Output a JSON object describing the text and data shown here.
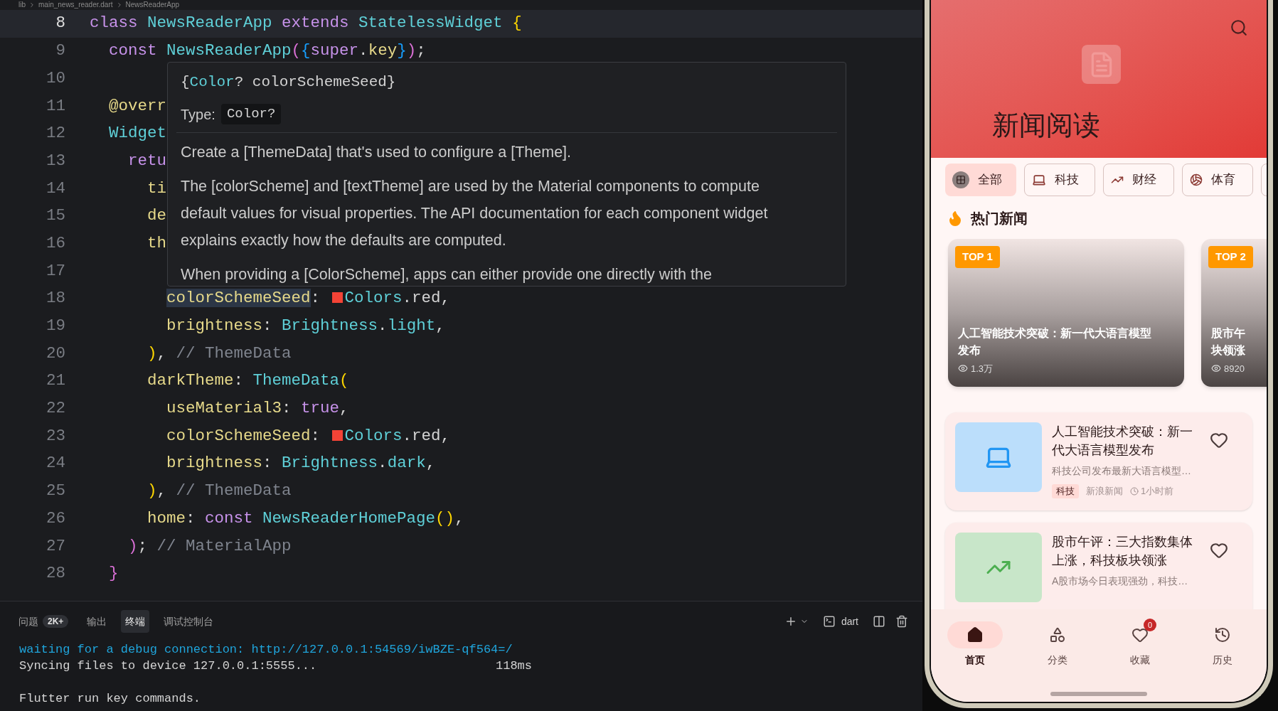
{
  "breadcrumb": [
    "lib",
    "main_news_reader.dart",
    "NewsReaderApp"
  ],
  "editor": {
    "lines": [
      {
        "number": "8",
        "current": true,
        "tokens": [
          {
            "kind": "kw",
            "text": "class "
          },
          {
            "kind": "type",
            "text": "NewsReaderApp "
          },
          {
            "kind": "kw",
            "text": "extends "
          },
          {
            "kind": "type",
            "text": "StatelessWidget "
          },
          {
            "kind": "b1",
            "text": "{"
          }
        ]
      },
      {
        "number": "9",
        "current": false,
        "tokens": [
          {
            "kind": "kw",
            "text": "  const "
          },
          {
            "kind": "type",
            "text": "NewsReaderApp"
          },
          {
            "kind": "b2",
            "text": "("
          },
          {
            "kind": "b3",
            "text": "{"
          },
          {
            "kind": "kw",
            "text": "super"
          },
          {
            "kind": "plain",
            "text": "."
          },
          {
            "kind": "prop",
            "text": "key"
          },
          {
            "kind": "b3",
            "text": "}"
          },
          {
            "kind": "b2",
            "text": ")"
          },
          {
            "kind": "plain",
            "text": ";"
          }
        ]
      },
      {
        "number": "10",
        "current": false
      },
      {
        "number": "11",
        "current": false,
        "tokens": [
          {
            "kind": "prop",
            "text": "  @overr"
          }
        ]
      },
      {
        "number": "12",
        "current": false,
        "tokens": [
          {
            "kind": "type",
            "text": "  Widget"
          }
        ]
      },
      {
        "number": "13",
        "current": false,
        "tokens": [
          {
            "kind": "kw",
            "text": "    retu"
          }
        ]
      },
      {
        "number": "14",
        "current": false,
        "tokens": [
          {
            "kind": "prop",
            "text": "      ti"
          }
        ]
      },
      {
        "number": "15",
        "current": false,
        "tokens": [
          {
            "kind": "prop",
            "text": "      de"
          }
        ]
      },
      {
        "number": "16",
        "current": false,
        "tokens": [
          {
            "kind": "prop",
            "text": "      th"
          }
        ]
      },
      {
        "number": "17",
        "current": false
      },
      {
        "number": "18",
        "current": false,
        "tokens": [
          {
            "kind": "prop",
            "text": "        colorSchemeSeed",
            "highlighted": true
          },
          {
            "kind": "plain",
            "text": ": "
          },
          {
            "kind": "swatch",
            "color": "#f44336"
          },
          {
            "kind": "type",
            "text": "Colors"
          },
          {
            "kind": "plain",
            "text": ".red,"
          }
        ]
      },
      {
        "number": "19",
        "current": false,
        "tokens": [
          {
            "kind": "prop",
            "text": "        brightness"
          },
          {
            "kind": "plain",
            "text": ": "
          },
          {
            "kind": "type",
            "text": "Brightness"
          },
          {
            "kind": "plain",
            "text": "."
          },
          {
            "kind": "type",
            "text": "light"
          },
          {
            "kind": "plain",
            "text": ","
          }
        ]
      },
      {
        "number": "20",
        "current": false,
        "tokens": [
          {
            "kind": "b1",
            "text": "      )"
          },
          {
            "kind": "plain",
            "text": ", "
          },
          {
            "kind": "comment",
            "text": "// ThemeData"
          }
        ]
      },
      {
        "number": "21",
        "current": false,
        "tokens": [
          {
            "kind": "prop",
            "text": "      darkTheme"
          },
          {
            "kind": "plain",
            "text": ": "
          },
          {
            "kind": "type",
            "text": "ThemeData"
          },
          {
            "kind": "b1",
            "text": "("
          }
        ]
      },
      {
        "number": "22",
        "current": false,
        "tokens": [
          {
            "kind": "prop",
            "text": "        useMaterial3"
          },
          {
            "kind": "plain",
            "text": ": "
          },
          {
            "kind": "kw",
            "text": "true"
          },
          {
            "kind": "plain",
            "text": ","
          }
        ]
      },
      {
        "number": "23",
        "current": false,
        "tokens": [
          {
            "kind": "prop",
            "text": "        colorSchemeSeed"
          },
          {
            "kind": "plain",
            "text": ": "
          },
          {
            "kind": "swatch",
            "color": "#f44336"
          },
          {
            "kind": "type",
            "text": "Colors"
          },
          {
            "kind": "plain",
            "text": ".red,"
          }
        ]
      },
      {
        "number": "24",
        "current": false,
        "tokens": [
          {
            "kind": "prop",
            "text": "        brightness"
          },
          {
            "kind": "plain",
            "text": ": "
          },
          {
            "kind": "type",
            "text": "Brightness"
          },
          {
            "kind": "plain",
            "text": "."
          },
          {
            "kind": "type",
            "text": "dark"
          },
          {
            "kind": "plain",
            "text": ","
          }
        ]
      },
      {
        "number": "25",
        "current": false,
        "tokens": [
          {
            "kind": "b1",
            "text": "      )"
          },
          {
            "kind": "plain",
            "text": ", "
          },
          {
            "kind": "comment",
            "text": "// ThemeData"
          }
        ]
      },
      {
        "number": "26",
        "current": false,
        "tokens": [
          {
            "kind": "prop",
            "text": "      home"
          },
          {
            "kind": "plain",
            "text": ": "
          },
          {
            "kind": "kw",
            "text": "const "
          },
          {
            "kind": "type",
            "text": "NewsReaderHomePage"
          },
          {
            "kind": "b1",
            "text": "()"
          },
          {
            "kind": "plain",
            "text": ","
          }
        ]
      },
      {
        "number": "27",
        "current": false,
        "tokens": [
          {
            "kind": "b2",
            "text": "    )"
          },
          {
            "kind": "plain",
            "text": "; "
          },
          {
            "kind": "comment",
            "text": "// MaterialApp"
          }
        ]
      },
      {
        "number": "28",
        "current": false,
        "tokens": [
          {
            "kind": "b2",
            "text": "  }"
          }
        ]
      }
    ]
  },
  "hover": {
    "signature": [
      {
        "kind": "plain",
        "text": "{"
      },
      {
        "kind": "type",
        "text": "Color"
      },
      {
        "kind": "plain",
        "text": "? colorSchemeSeed}"
      }
    ],
    "type_label": "Type:",
    "type_value": "Color?",
    "paragraphs": [
      "Create a [ThemeData] that's used to configure a [Theme].",
      "The [colorScheme] and [textTheme] are used by the Material components to compute default values for visual properties. The API documentation for each component widget explains exactly how the defaults are computed.",
      "When providing a [ColorScheme], apps can either provide one directly with the"
    ]
  },
  "panel": {
    "tabs": [
      {
        "label": "问题",
        "badge": "2K+",
        "selected": false
      },
      {
        "label": "输出",
        "selected": false
      },
      {
        "label": "终端",
        "selected": true
      },
      {
        "label": "调试控制台",
        "selected": false
      }
    ],
    "terminal_name": "dart",
    "output": [
      {
        "kind": "link",
        "text": "waiting for a debug connection: http://127.0.0.1:54569/iwBZE-qf564=/"
      },
      {
        "kind": "timed",
        "text": "Syncing files to device 127.0.0.1:5555...",
        "time": "118ms"
      },
      {
        "kind": "blank"
      },
      {
        "kind": "plain",
        "text": "Flutter run key commands."
      }
    ]
  },
  "app": {
    "title": "新闻阅读",
    "categories": [
      {
        "label": "全部",
        "kind": "grid",
        "selected": true
      },
      {
        "label": "科技",
        "kind": "laptop",
        "selected": false
      },
      {
        "label": "财经",
        "kind": "trend",
        "selected": false
      },
      {
        "label": "体育",
        "kind": "ball",
        "selected": false
      },
      {
        "kind": "cut",
        "selected": false
      }
    ],
    "hot_title": "热门新闻",
    "hot": [
      {
        "badge": "TOP 1",
        "title_lines": [
          "人工智能技术突破：新一代大语言模型",
          "发布"
        ],
        "views": "1.3万"
      },
      {
        "badge": "TOP 2",
        "title_lines": [
          "股市午",
          "块领涨"
        ],
        "views": "8920"
      }
    ],
    "news": [
      {
        "kind": "laptop",
        "color": "#bbdefb",
        "title": "人工智能技术突破：新一代大语言模型发布",
        "summary": "科技公司发布最新大语言模型…",
        "tag": "科技",
        "source": "新浪新闻",
        "time": "1小时前"
      },
      {
        "kind": "trend",
        "color": "#c8e6c9",
        "title": "股市午评：三大指数集体上涨，科技板块领涨",
        "summary": "A股市场今日表现强劲，科技…"
      }
    ],
    "nav": [
      {
        "label": "首页",
        "kind": "home",
        "selected": true
      },
      {
        "label": "分类",
        "kind": "shapes",
        "selected": false
      },
      {
        "label": "收藏",
        "kind": "heart",
        "badge": "0",
        "selected": false
      },
      {
        "label": "历史",
        "kind": "history",
        "selected": false
      }
    ]
  }
}
